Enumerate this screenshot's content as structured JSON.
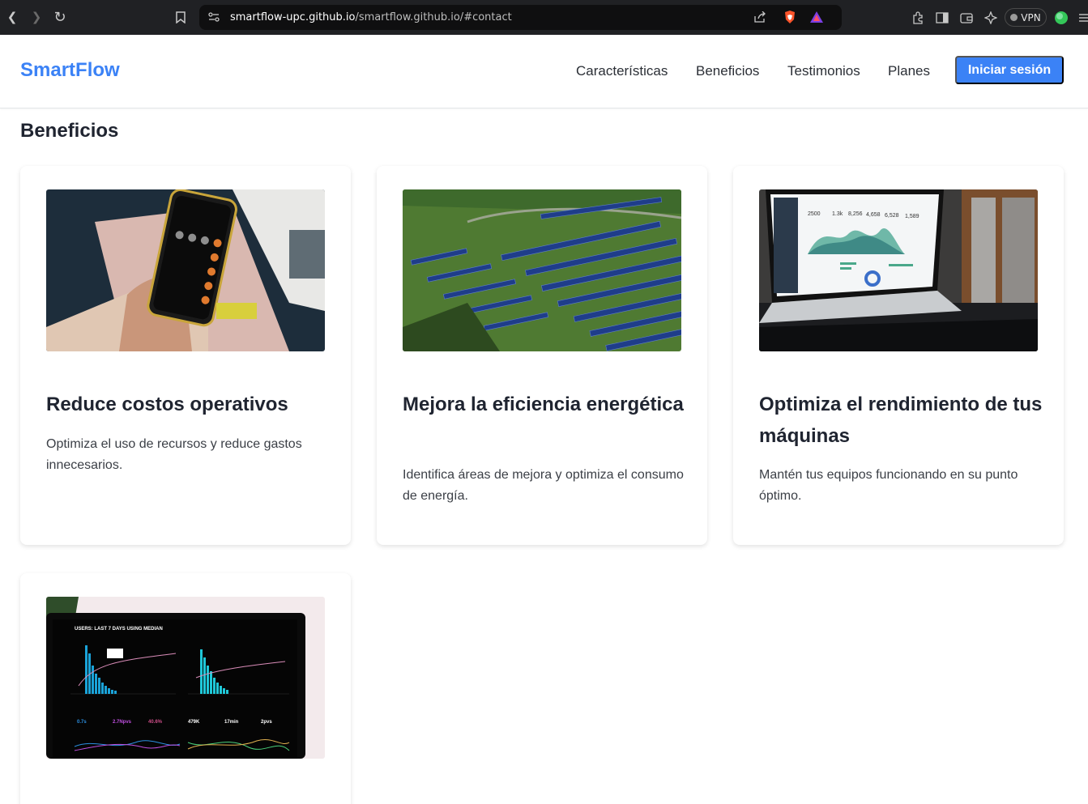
{
  "browser": {
    "url_host": "smartflow-upc.github.io",
    "url_path": "/smartflow.github.io/#contact",
    "vpn_label": "VPN"
  },
  "header": {
    "logo": "SmartFlow",
    "nav": [
      {
        "label": "Características"
      },
      {
        "label": "Beneficios"
      },
      {
        "label": "Testimonios"
      },
      {
        "label": "Planes"
      }
    ],
    "login_label": "Iniciar sesión"
  },
  "section": {
    "title": "Beneficios",
    "cards": [
      {
        "title": "Reduce costos operativos",
        "description": "Optimiza el uso de recursos y reduce gastos innecesarios.",
        "image": "phone-calculator-photo"
      },
      {
        "title": "Mejora la eficiencia energética",
        "description": "Identifica áreas de mejora y optimiza el consumo de energía.",
        "image": "solar-panels-photo"
      },
      {
        "title": "Optimiza el rendimiento de tus máquinas",
        "description": "Mantén tus equipos funcionando en su punto óptimo.",
        "image": "laptop-dashboard-photo"
      },
      {
        "title": "",
        "description": "",
        "image": "analytics-monitor-photo"
      }
    ]
  },
  "monitor_text": {
    "header": "USERS: LAST 7 DAYS USING MEDIAN",
    "stats": [
      "0.7s",
      "2.7Npvs",
      "40.6%",
      "479K",
      "17min",
      "2pvs"
    ]
  },
  "laptop_text": {
    "stats": [
      "2500",
      "1.3k",
      "8,256",
      "4,658",
      "6,528",
      "1,589"
    ]
  },
  "colors": {
    "accent": "#3b82f6",
    "text": "#1f2430",
    "browser_bg": "#202124"
  }
}
